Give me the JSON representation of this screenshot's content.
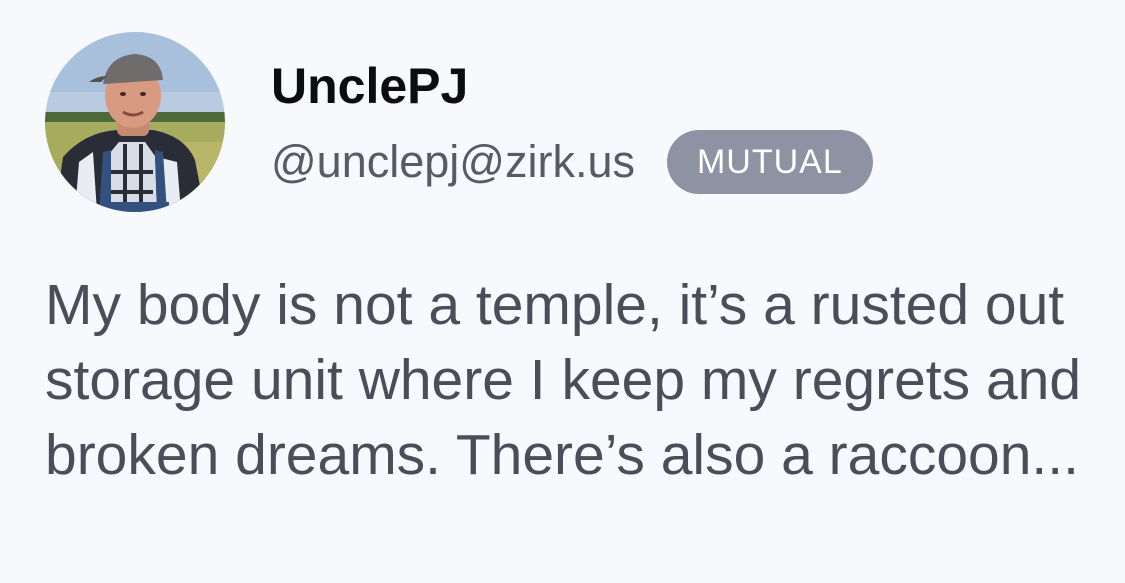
{
  "post": {
    "author": {
      "display_name": "UnclePJ",
      "handle": "@unclepj@zirk.us",
      "avatar_icon": "profile-photo"
    },
    "relationship_badge": "MUTUAL",
    "content": "My body is not a temple, it’s a rusted out storage unit where I keep my regrets and broken dreams. There’s also a raccoon..."
  },
  "colors": {
    "background": "#f8f9fd",
    "display_name": "#0d0d0f",
    "handle": "#585b66",
    "badge_bg": "#8d93a3",
    "badge_text": "#ffffff",
    "body_text": "#4b4e58"
  }
}
